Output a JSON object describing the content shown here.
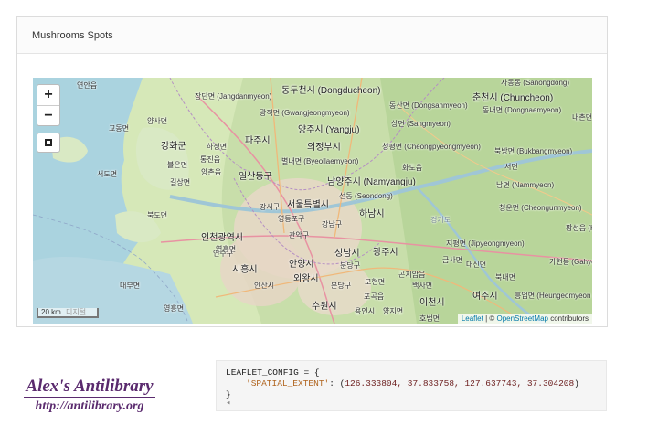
{
  "card": {
    "title": "Mushrooms Spots"
  },
  "map": {
    "zoom_in": "+",
    "zoom_out": "−",
    "scale": "20 km",
    "scale_extra": "디지털",
    "attribution": {
      "leaflet": "Leaflet",
      "sep": " | © ",
      "osm": "OpenStreetMap",
      "contributors": " contributors"
    },
    "labels": [
      "연안읍",
      "장단면 (Jangdanmyeon)",
      "동두천시 (Dongducheon)",
      "사동동 (Sanongdong)",
      "춘천시 (Chuncheon)",
      "동산면 (Dongsanmyeon)",
      "광적면 (Gwangjeongmyeon)",
      "양주시 (Yangju)",
      "상면 (Sangmyeon)",
      "동내면 (Dongnaemyeon)",
      "내촌면",
      "교동면",
      "양사면",
      "파주시",
      "의정부시",
      "청평면 (Cheongpyeongmyeon)",
      "북방면 (Bukbangmyeon)",
      "강화군",
      "하성면",
      "통진읍",
      "일산동구",
      "별내면 (Byeollaemyeon)",
      "남양주시 (Namyangju)",
      "화도읍",
      "서면",
      "불은면",
      "양촌읍",
      "남면 (Nammyeon)",
      "서도면",
      "길상면",
      "서울특별시",
      "하남시",
      "선동 (Seondong)",
      "청운면 (Cheongunmyeon)",
      "북도면",
      "강서구",
      "영등포구",
      "강남구",
      "경기도",
      "황성읍 (Hoeng",
      "인천광역시",
      "관악구",
      "광주시",
      "지평면 (Jipyeongmyeon)",
      "영흥면",
      "연수구",
      "성남시",
      "금사면",
      "가현동 (Gahyeond",
      "시흥시",
      "안양시",
      "분당구",
      "곤지암읍",
      "대신면",
      "외왕시",
      "분당구",
      "북내면",
      "안산시",
      "모현면",
      "백사면",
      "여주시",
      "흥업면 (Heungeomyeon",
      "대부면",
      "영흥면",
      "수원시",
      "포곡읍",
      "이천시",
      "용인시",
      "양지면",
      "호법면"
    ]
  },
  "logo": {
    "title": "Alex's Antilibrary",
    "url": "http://antilibrary.org"
  },
  "code": {
    "line1": "LEAFLET_CONFIG = {",
    "key": "'SPATIAL_EXTENT'",
    "colon": ": (",
    "values": "126.333804, 37.833758, 127.637743, 37.304208",
    "close_paren": ")",
    "line3": "}",
    "scroll_arrow": "◂"
  },
  "colors": {
    "accent": "#0078a8",
    "logo": "#5a2a6e",
    "code_key": "#b0641e"
  }
}
